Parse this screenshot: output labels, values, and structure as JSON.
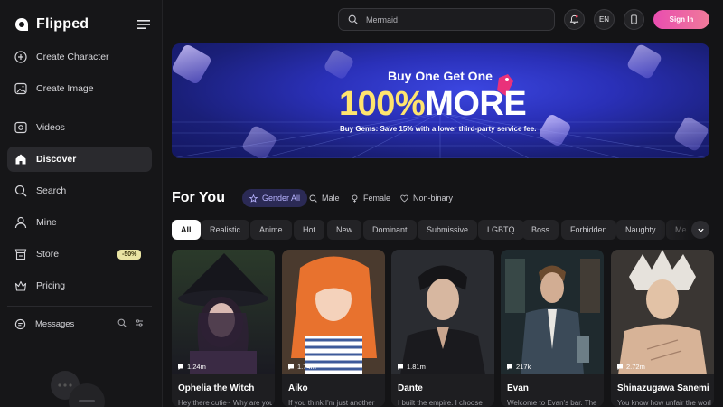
{
  "app": {
    "name": "Flipped"
  },
  "sidebar": {
    "items": [
      {
        "label": "Create Character",
        "icon": "plus-circle-icon"
      },
      {
        "label": "Create Image",
        "icon": "image-icon"
      },
      {
        "label": "Videos",
        "icon": "video-icon"
      },
      {
        "label": "Discover",
        "icon": "home-icon",
        "active": true
      },
      {
        "label": "Search",
        "icon": "search-icon"
      },
      {
        "label": "Mine",
        "icon": "user-icon"
      },
      {
        "label": "Store",
        "icon": "store-icon",
        "badge": "-50%"
      },
      {
        "label": "Pricing",
        "icon": "crown-icon"
      }
    ],
    "messages_label": "Messages"
  },
  "topbar": {
    "search_value": "Mermaid",
    "language": "EN",
    "signin_label": "Sign In"
  },
  "banner": {
    "headline": "Buy One Get One",
    "big_number": "100%",
    "big_word": "MORE",
    "subtext": "Buy Gems: Save 15% with a lower third-party service fee."
  },
  "foryou": {
    "title": "For You",
    "gender_filters": [
      {
        "label": "Gender All",
        "icon": "star-icon",
        "active": true
      },
      {
        "label": "Male",
        "icon": "search-icon"
      },
      {
        "label": "Female",
        "icon": "female-icon"
      },
      {
        "label": "Non-binary",
        "icon": "heart-icon"
      }
    ],
    "tags": [
      "All",
      "Realistic",
      "Anime",
      "Hot",
      "New",
      "Dominant",
      "Submissive",
      "LGBTQ",
      "Boss",
      "Forbidden",
      "Naughty",
      "Me"
    ]
  },
  "cards": [
    {
      "name": "Ophelia the Witch",
      "views": "1.24m",
      "desc": "Hey there cutie~ Why are you"
    },
    {
      "name": "Aiko",
      "views": "1.74m",
      "desc": "If you think I'm just another"
    },
    {
      "name": "Dante",
      "views": "1.81m",
      "desc": "I built the empire. I choose"
    },
    {
      "name": "Evan",
      "views": "217k",
      "desc": "Welcome to Evan's bar. The"
    },
    {
      "name": "Shinazugawa Sanemi",
      "views": "2.72m",
      "desc": "You know how unfair the world is."
    }
  ],
  "colors": {
    "background": "#141416",
    "accent_pink": "#e94db0",
    "active_filter": "#2b2a55",
    "banner_yellow": "#ffe46e",
    "store_badge": "#e9e4a3"
  }
}
